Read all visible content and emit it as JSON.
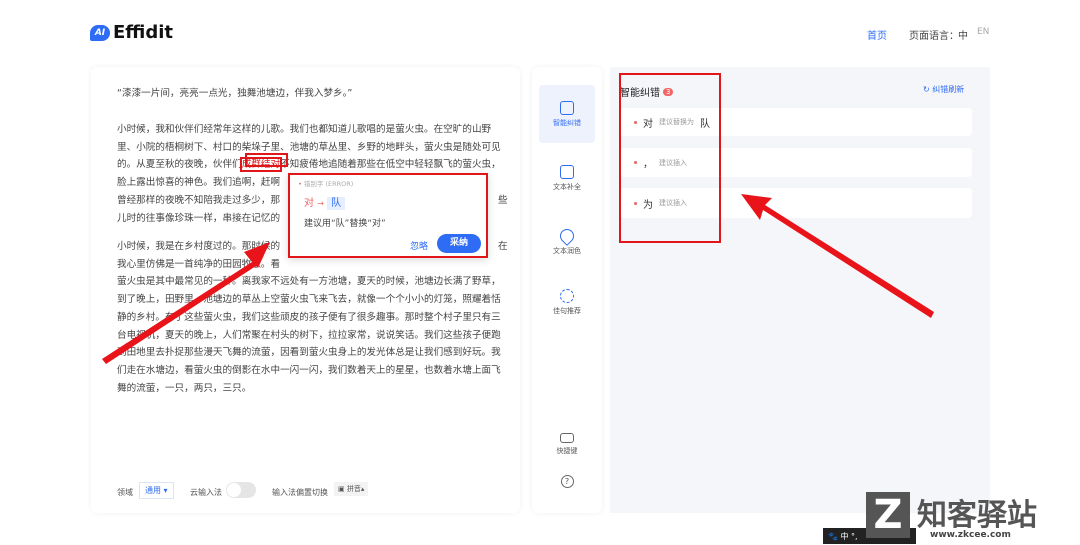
{
  "header": {
    "logo_mark": "AI",
    "logo_text": "Effidit",
    "home": "首页",
    "lang_label": "页面语言：",
    "lang_zh": "中",
    "lang_en": "EN"
  },
  "editor": {
    "quote": "“漆漆一片间，亮亮一点光，独舞池塘边，伴我入梦乡。”",
    "p1": [
      "小时候，我和伙伴们经常年这样的儿歌。我们也都知道儿歌唱的是萤火虫。在空旷的山野",
      "里、小院的梧桐树下、村口的柴垛子里、池塘的草丛里、乡野的地畔头，萤火虫是随处可见"
    ],
    "p1_l3a": "的。从夏至秋的夜晚，伙伴们",
    "p1_l3_hl": "成群结对",
    "p1_l3b": "不知疲倦地追随着那些在低空中轻轻飘飞的萤火虫，",
    "p1_l4": "脸上露出惊喜的神色。我们追啊，赶啊",
    "p1_l5": "曾经那样的夜晚不知陪我走过多少，那",
    "p1_l5_end": "些",
    "p1_l6": "儿时的往事像珍珠一样，串接在记忆的",
    "p2_l1": "小时候，我是在乡村度过的。那时候的",
    "p2_l1_end": "在",
    "p2_l2": "我心里仿佛是一首纯净的田园牧歌。看",
    "p2": [
      "萤火虫是其中最常见的一种。离我家不远处有一方池塘，夏天的时候，池塘边长满了野草，",
      "到了晚上，田野里、池塘边的草丛上空萤火虫飞来飞去，就像一个个小小的灯笼，照耀着恬",
      "静的乡村。有了这些萤火虫，我们这些顽皮的孩子便有了很多趣事。那时整个村子里只有三",
      "台电视机，夏天的晚上，人们常聚在村头的树下，拉拉家常，说说笑话。我们这些孩子便跑",
      "到田地里去扑捉那些漫天飞舞的流萤，因看到萤火虫身上的发光体总是让我们感到好玩。我",
      "们走在水塘边，看萤火虫的倒影在水中一闪一闪，我们数着天上的星星，也数着水塘上面飞",
      "舞的流萤，一只，两只，三只。"
    ]
  },
  "popup": {
    "type": "错别字 (ERROR)",
    "from": "对",
    "arrow": "→",
    "to": "队",
    "suggestion": "建议用“队”替换“对”",
    "ignore": "忽略",
    "accept": "采纳"
  },
  "bottom": {
    "domain_label": "领域",
    "domain_value": "通用",
    "cloud_ime": "云输入法",
    "ime_switch": "输入法偏置切换",
    "ime_value": "拼音"
  },
  "tools": {
    "items": [
      "智能纠错",
      "文本补全",
      "文本润色",
      "佳句推荐"
    ],
    "shortcut": "快捷键",
    "help": "?"
  },
  "panel": {
    "title": "智能纠错",
    "count": "3",
    "refresh": "纠错刷新",
    "items": [
      {
        "word": "对",
        "hint": "建议替换为",
        "target": "队"
      },
      {
        "word": "，",
        "hint": "建议插入",
        "target": ""
      },
      {
        "word": "为",
        "hint": "建议插入",
        "target": ""
      }
    ]
  },
  "watermark": {
    "text": "知客驿站",
    "url": "www.zkcee.com"
  },
  "taskbar": {
    "ime": "中"
  },
  "colors": {
    "accent": "#2e6cf6",
    "annotation": "#e0161b"
  }
}
